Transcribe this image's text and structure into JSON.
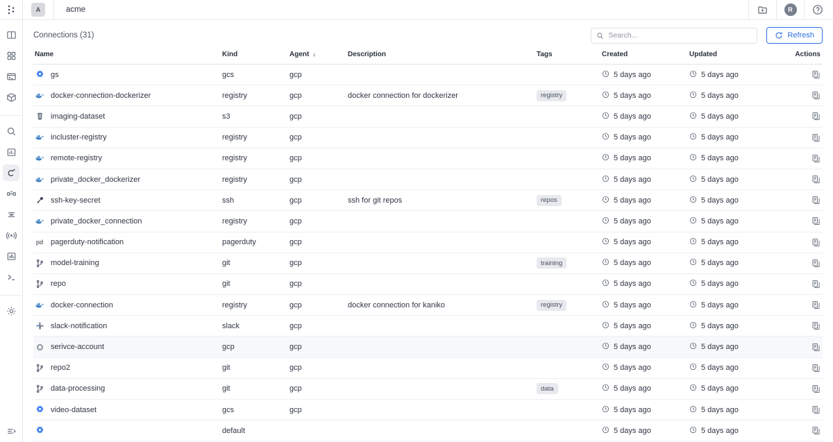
{
  "topbar": {
    "tab_badge": "A",
    "tab_title": "acme",
    "actions": [
      {
        "name": "new-folder-icon",
        "label": "New folder"
      },
      {
        "name": "user-avatar",
        "label": "R"
      },
      {
        "name": "help-icon",
        "label": "Help"
      }
    ]
  },
  "rail": {
    "groups": [
      {
        "items": [
          {
            "name": "panels-icon",
            "label": "Panels",
            "active": false
          },
          {
            "name": "apps-grid-icon",
            "label": "Apps",
            "active": false
          },
          {
            "name": "terminal-window-icon",
            "label": "Workspaces",
            "active": false
          },
          {
            "name": "package-icon",
            "label": "Packages",
            "active": false
          }
        ]
      },
      {
        "divided": true,
        "items": [
          {
            "name": "search-icon",
            "label": "Search",
            "active": false
          },
          {
            "name": "chart-icon",
            "label": "Metrics",
            "active": false
          },
          {
            "name": "connections-icon",
            "label": "Connections",
            "active": true
          },
          {
            "name": "pipeline-icon",
            "label": "Pipelines",
            "active": false
          },
          {
            "name": "stack-icon",
            "label": "Stacks",
            "active": false
          },
          {
            "name": "broadcast-icon",
            "label": "Events",
            "active": false
          },
          {
            "name": "bar-chart-icon",
            "label": "Reports",
            "active": false
          },
          {
            "name": "console-icon",
            "label": "Console",
            "active": false
          }
        ]
      },
      {
        "divided": true,
        "items": [
          {
            "name": "settings-gear-icon",
            "label": "Settings",
            "active": false
          }
        ]
      }
    ],
    "bottom": {
      "name": "collapse-sidebar-icon",
      "label": "Collapse"
    }
  },
  "toolbar": {
    "title": "Connections (31)",
    "search_placeholder": "Search...",
    "search_value": "",
    "refresh_label": "Refresh"
  },
  "table": {
    "columns": [
      {
        "key": "name",
        "label": "Name"
      },
      {
        "key": "kind",
        "label": "Kind"
      },
      {
        "key": "agent",
        "label": "Agent",
        "sorted": "desc",
        "sort_glyph": "↓"
      },
      {
        "key": "description",
        "label": "Description"
      },
      {
        "key": "tags",
        "label": "Tags"
      },
      {
        "key": "created",
        "label": "Created"
      },
      {
        "key": "updated",
        "label": "Updated"
      },
      {
        "key": "actions",
        "label": "Actions"
      }
    ],
    "rows": [
      {
        "icon": "gcs-icon",
        "name": "gs",
        "kind": "gcs",
        "agent": "gcp",
        "description": "",
        "tag": "",
        "created": "5 days ago",
        "updated": "5 days ago",
        "hover": false
      },
      {
        "icon": "docker-icon",
        "name": "docker-connection-dockerizer",
        "kind": "registry",
        "agent": "gcp",
        "description": "docker connection for dockerizer",
        "tag": "registry",
        "created": "5 days ago",
        "updated": "5 days ago",
        "hover": false
      },
      {
        "icon": "s3-icon",
        "name": "imaging-dataset",
        "kind": "s3",
        "agent": "gcp",
        "description": "",
        "tag": "",
        "created": "5 days ago",
        "updated": "5 days ago",
        "hover": false
      },
      {
        "icon": "docker-icon",
        "name": "incluster-registry",
        "kind": "registry",
        "agent": "gcp",
        "description": "",
        "tag": "",
        "created": "5 days ago",
        "updated": "5 days ago",
        "hover": false
      },
      {
        "icon": "docker-icon",
        "name": "remote-registry",
        "kind": "registry",
        "agent": "gcp",
        "description": "",
        "tag": "",
        "created": "5 days ago",
        "updated": "5 days ago",
        "hover": false
      },
      {
        "icon": "docker-icon",
        "name": "private_docker_dockerizer",
        "kind": "registry",
        "agent": "gcp",
        "description": "",
        "tag": "",
        "created": "5 days ago",
        "updated": "5 days ago",
        "hover": false
      },
      {
        "icon": "key-icon",
        "name": "ssh-key-secret",
        "kind": "ssh",
        "agent": "gcp",
        "description": "ssh for git repos",
        "tag": "repos",
        "created": "5 days ago",
        "updated": "5 days ago",
        "hover": false
      },
      {
        "icon": "docker-icon",
        "name": "private_docker_connection",
        "kind": "registry",
        "agent": "gcp",
        "description": "",
        "tag": "",
        "created": "5 days ago",
        "updated": "5 days ago",
        "hover": false
      },
      {
        "icon": "pagerduty-icon",
        "name": "pagerduty-notification",
        "kind": "pagerduty",
        "agent": "gcp",
        "description": "",
        "tag": "",
        "created": "5 days ago",
        "updated": "5 days ago",
        "hover": false
      },
      {
        "icon": "git-branch-icon",
        "name": "model-training",
        "kind": "git",
        "agent": "gcp",
        "description": "",
        "tag": "training",
        "created": "5 days ago",
        "updated": "5 days ago",
        "hover": false
      },
      {
        "icon": "git-branch-icon",
        "name": "repo",
        "kind": "git",
        "agent": "gcp",
        "description": "",
        "tag": "",
        "created": "5 days ago",
        "updated": "5 days ago",
        "hover": false
      },
      {
        "icon": "docker-icon",
        "name": "docker-connection",
        "kind": "registry",
        "agent": "gcp",
        "description": "docker connection for kaniko",
        "tag": "registry",
        "created": "5 days ago",
        "updated": "5 days ago",
        "hover": false
      },
      {
        "icon": "slack-icon",
        "name": "slack-notification",
        "kind": "slack",
        "agent": "gcp",
        "description": "",
        "tag": "",
        "created": "5 days ago",
        "updated": "5 days ago",
        "hover": false
      },
      {
        "icon": "gcp-icon",
        "name": "serivce-account",
        "kind": "gcp",
        "agent": "gcp",
        "description": "",
        "tag": "",
        "created": "5 days ago",
        "updated": "5 days ago",
        "hover": true
      },
      {
        "icon": "git-branch-icon",
        "name": "repo2",
        "kind": "git",
        "agent": "gcp",
        "description": "",
        "tag": "",
        "created": "5 days ago",
        "updated": "5 days ago",
        "hover": false
      },
      {
        "icon": "git-branch-icon",
        "name": "data-processing",
        "kind": "git",
        "agent": "gcp",
        "description": "",
        "tag": "data",
        "created": "5 days ago",
        "updated": "5 days ago",
        "hover": false
      },
      {
        "icon": "gcs-icon",
        "name": "video-dataset",
        "kind": "gcs",
        "agent": "gcp",
        "description": "",
        "tag": "",
        "created": "5 days ago",
        "updated": "5 days ago",
        "hover": false
      },
      {
        "icon": "gcs-icon",
        "name": "",
        "kind": "default",
        "agent": "",
        "description": "",
        "tag": "",
        "created": "5 days ago",
        "updated": "5 days ago",
        "hover": false
      }
    ],
    "row_action_icon": "copy-icon"
  },
  "colors": {
    "accent": "#2f6fe4",
    "docker_blue": "#3e7fc1",
    "gcs_blue": "#4285f4",
    "border": "#e6e8ec",
    "tag_bg": "#e7e9ee"
  }
}
